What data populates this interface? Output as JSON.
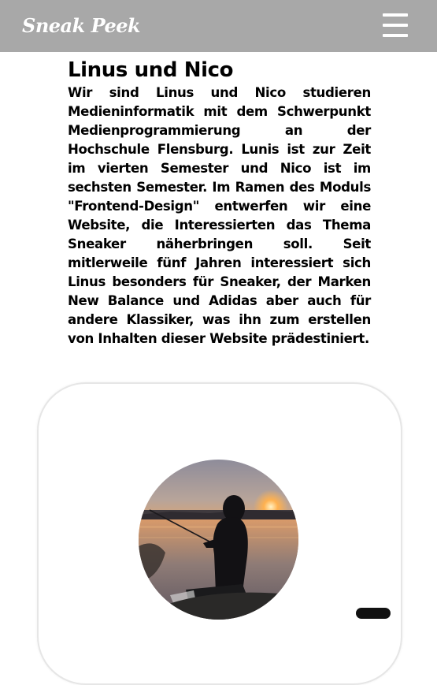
{
  "header": {
    "logo_text": "Sneak Peek",
    "menu_icon": "hamburger-menu-icon",
    "background_color": "#a8a8a8"
  },
  "about": {
    "title": "Linus und Nico",
    "text": "Wir sind Linus und Nico studieren Medieninformatik mit dem Schwerpunkt Medienprogrammierung an der Hochschule Flensburg. Lunis ist zur Zeit im vierten Semester und Nico ist im sechsten Semester. Im Ramen des Moduls \"Frontend-Design\" entwerfen wir eine Website, die Interessierten das Thema Sneaker näherbringen soll. Seit mitlerweile fünf Jahren interessiert sich Linus besonders für Sneaker, der Marken New Balance und Adidas aber auch für andere Klassiker, was ihn zum erstellen von Inhalten dieser Website prädestiniert."
  },
  "profile_card": {
    "photo_subject": "person fishing at sunset silhouette"
  }
}
